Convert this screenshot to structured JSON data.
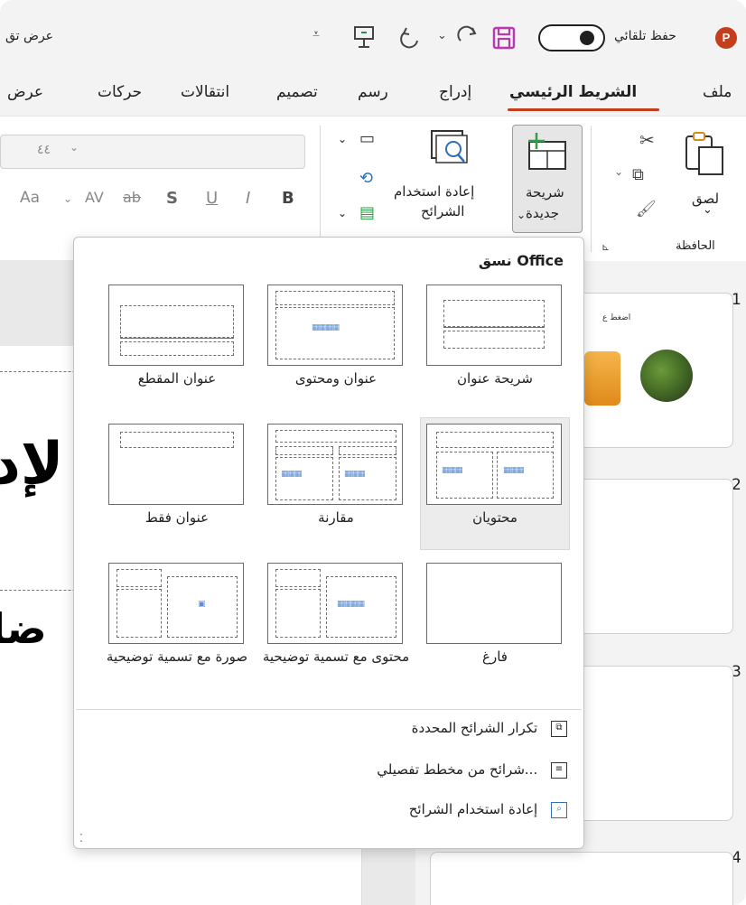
{
  "titlebar": {
    "app_icon": "P",
    "autosave_label": "حفظ تلقائي",
    "presenter_name": "عرض تق",
    "icons": [
      "save-icon",
      "redo-icon",
      "undo-icon",
      "presenter-icon",
      "customize-icon"
    ]
  },
  "tabs": [
    "ملف",
    "الشريط الرئيسي",
    "إدراج",
    "رسم",
    "تصميم",
    "انتقالات",
    "حركات",
    "عرض"
  ],
  "active_tab": "الشريط الرئيسي",
  "ribbon": {
    "paste_label": "لصق",
    "clipboard_group": "الحافظة",
    "new_slide_line1": "شريحة",
    "new_slide_line2": "جديدة",
    "reuse_line1": "إعادة استخدام",
    "reuse_line2": "الشرائح",
    "font_size_value": "٤٤",
    "font_buttons": [
      "B",
      "I",
      "U",
      "S",
      "ab",
      "AV",
      "Aa"
    ]
  },
  "dropdown": {
    "header": "نسق Office",
    "layouts": [
      {
        "label": "شريحة عنوان"
      },
      {
        "label": "عنوان ومحتوى"
      },
      {
        "label": "عنوان المقطع"
      },
      {
        "label": "محتويان"
      },
      {
        "label": "مقارنة"
      },
      {
        "label": "عنوان فقط"
      },
      {
        "label": "فارغ"
      },
      {
        "label": "محتوى مع تسمية توضيحية"
      },
      {
        "label": "صورة مع تسمية توضيحية"
      }
    ],
    "selected_layout": "محتويان",
    "menu": [
      {
        "label": "تكرار الشرائح المحددة",
        "icon": "duplicate-slides-icon"
      },
      {
        "label": "شرائح من مخطط تفصيلي...",
        "icon": "outline-document-icon"
      },
      {
        "label": "إعادة استخدام الشرائح",
        "icon": "reuse-slides-icon"
      }
    ]
  },
  "thumbnails": {
    "numbers": [
      "1",
      "2",
      "3",
      "4"
    ],
    "slide1_caption": "اضغط ع"
  },
  "colors": {
    "accent": "#c43e1c",
    "toggle": "#1f1f1f",
    "save": "#b53baf"
  }
}
